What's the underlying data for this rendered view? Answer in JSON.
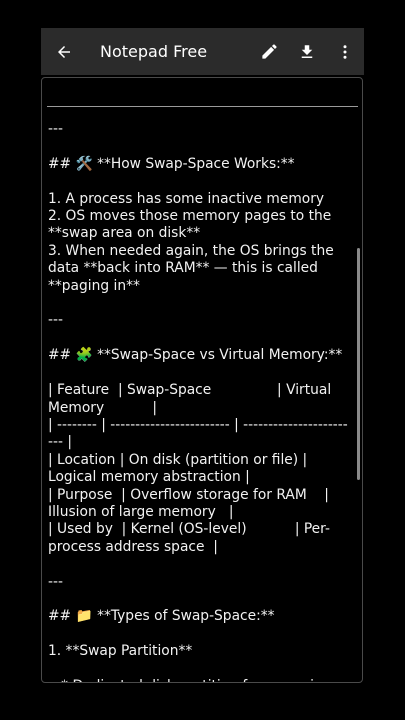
{
  "appbar": {
    "title": "Notepad Free",
    "icons": [
      "back-arrow-icon",
      "pencil-icon",
      "download-icon",
      "more-vert-icon"
    ]
  },
  "editor": {
    "content": "---\n\n## 🛠️ **How Swap-Space Works:**\n\n1. A process has some inactive memory\n2. OS moves those memory pages to the **swap area on disk**\n3. When needed again, the OS brings the data **back into RAM** — this is called **paging in**\n\n---\n\n## 🧩 **Swap-Space vs Virtual Memory:**\n\n| Feature  | Swap-Space               | Virtual Memory           |\n| -------- | ------------------------ | ------------------------ |\n| Location | On disk (partition or file) | Logical memory abstraction |\n| Purpose  | Overflow storage for RAM    | Illusion of large memory   |\n| Used by  | Kernel (OS-level)           | Per-process address space  |\n\n---\n\n## 📁 **Types of Swap-Space:**\n\n1. **Swap Partition**\n\n   * Dedicated disk partition for swapping"
  },
  "colors": {
    "background": "#000000",
    "appbar": "#2b2b2b",
    "text": "#f2f2f2"
  }
}
